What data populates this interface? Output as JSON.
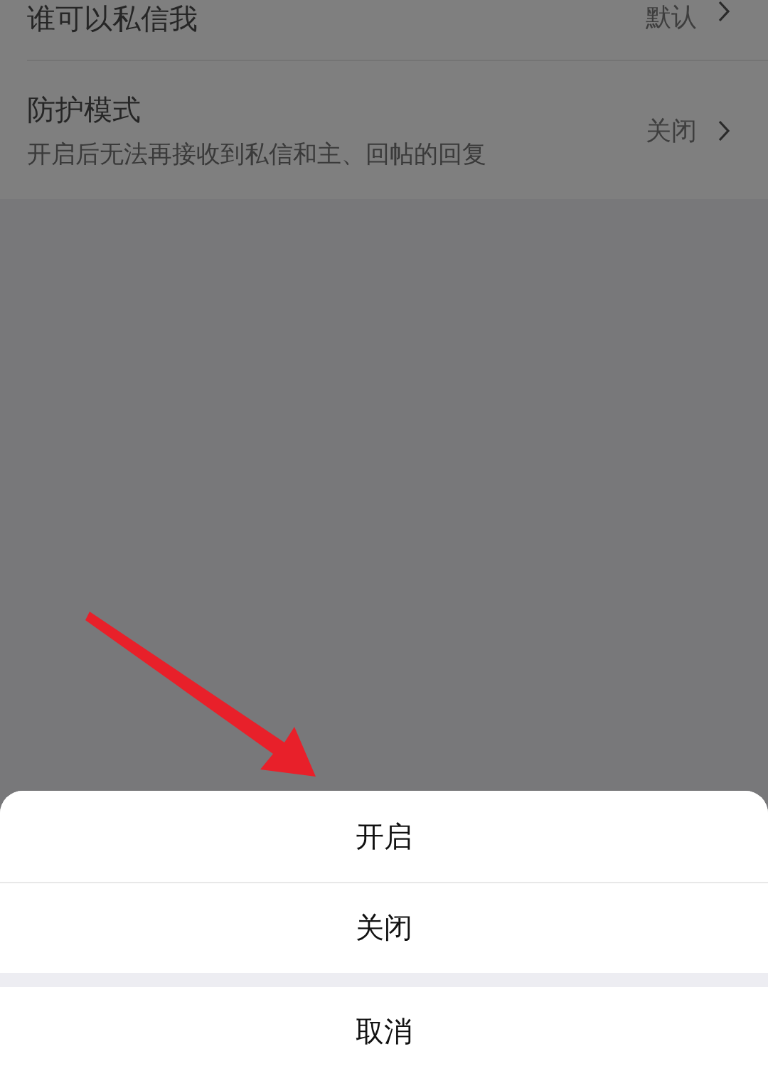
{
  "settings": [
    {
      "title": "谁可以私信我",
      "value": "默认"
    },
    {
      "title": "防护模式",
      "description": "开启后无法再接收到私信和主、回帖的回复",
      "value": "关闭"
    }
  ],
  "action_sheet": {
    "options": [
      "开启",
      "关闭"
    ],
    "cancel": "取消"
  }
}
